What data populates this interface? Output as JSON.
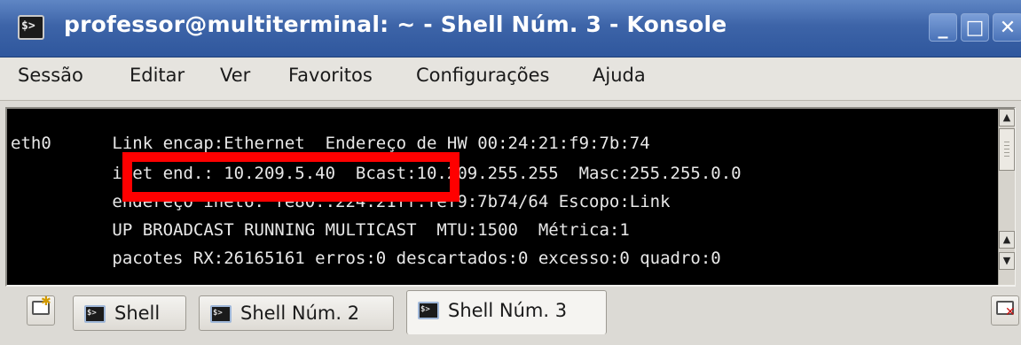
{
  "window": {
    "title": "professor@multiterminal: ~ - Shell Núm. 3 - Konsole",
    "app_icon_text": "$>",
    "minimize_glyph": "_",
    "maximize_glyph": "□",
    "close_glyph": "✕"
  },
  "menu": {
    "items": [
      {
        "label": "Sessão"
      },
      {
        "label": "Editar"
      },
      {
        "label": "Ver"
      },
      {
        "label": "Favoritos"
      },
      {
        "label": "Configurações"
      },
      {
        "label": "Ajuda"
      }
    ]
  },
  "terminal": {
    "lines": [
      "eth0      Link encap:Ethernet  Endereço de HW 00:24:21:f9:7b:74",
      "          inet end.: 10.209.5.40  Bcast:10.209.255.255  Masc:255.255.0.0",
      "          endereço inet6: fe80::224:21ff:fef9:7b74/64 Escopo:Link",
      "          UP BROADCAST RUNNING MULTICAST  MTU:1500  Métrica:1",
      "          pacotes RX:26165161 erros:0 descartados:0 excesso:0 quadro:0"
    ],
    "highlight_color": "#ff0000"
  },
  "scrollbar": {
    "up_arrow": "▲",
    "down_arrow": "▼"
  },
  "tabs": [
    {
      "label": "Shell",
      "active": false
    },
    {
      "label": "Shell Núm. 2",
      "active": false
    },
    {
      "label": "Shell Núm. 3",
      "active": true
    }
  ],
  "colors": {
    "titlebar": "#3d64a8",
    "terminal_bg": "#000000",
    "terminal_fg": "#e8e8e8"
  }
}
